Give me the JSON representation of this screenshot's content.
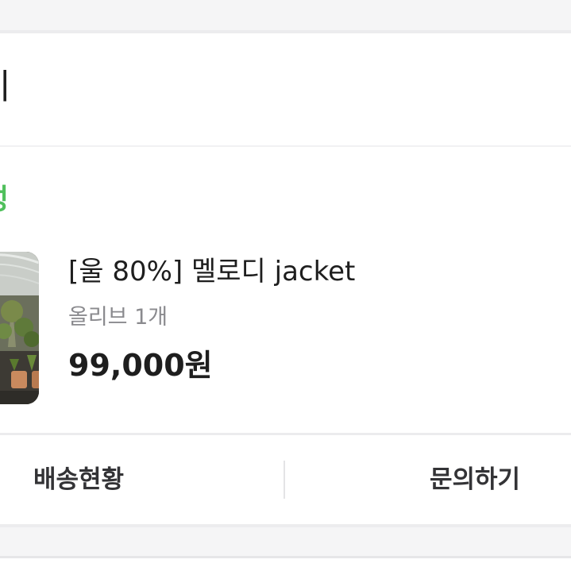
{
  "header": {
    "title": "이"
  },
  "order": {
    "status": "성",
    "product": {
      "name": "[울 80%] 멜로디 jacket",
      "option": "올리브 1개",
      "price": "99,000원",
      "thumbnail_icon": "product-thumbnail-image"
    }
  },
  "actions": {
    "shipping_label": "배송현황",
    "inquiry_label": "문의하기"
  },
  "colors": {
    "status_green": "#50c05c",
    "text_primary": "#1e1e1e",
    "text_secondary": "#8a8a8e",
    "divider": "#ececee"
  }
}
